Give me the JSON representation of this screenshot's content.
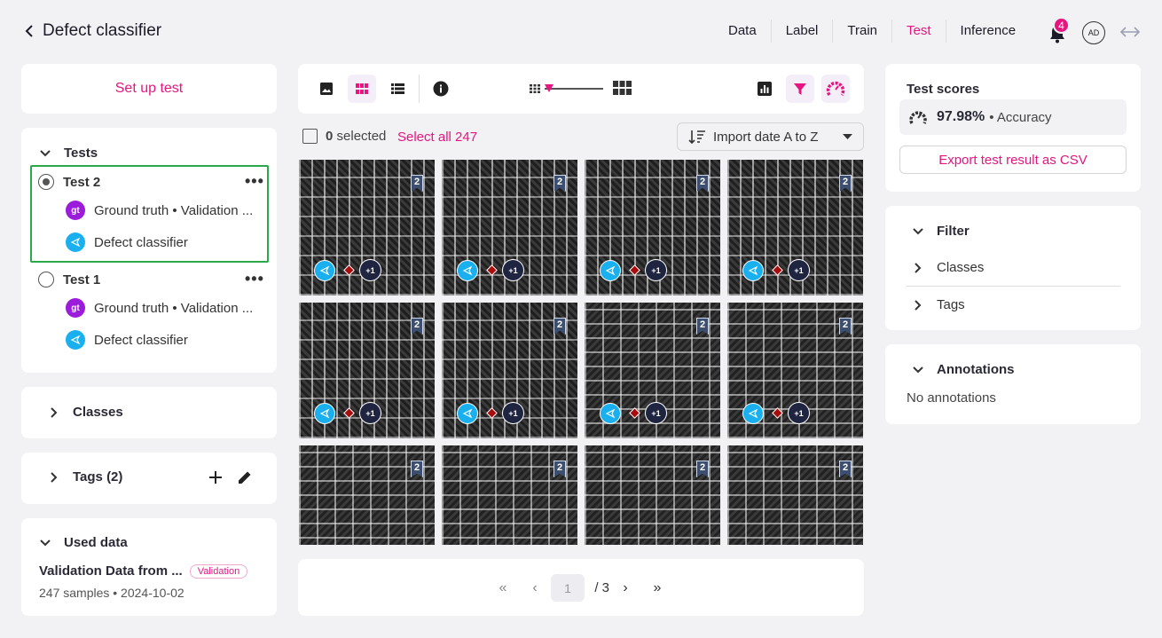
{
  "header": {
    "title": "Defect classifier",
    "nav": [
      "Data",
      "Label",
      "Train",
      "Test",
      "Inference"
    ],
    "active_nav": "Test",
    "notification_count": "4",
    "avatar_initials": "AD"
  },
  "left": {
    "setup_label": "Set up test",
    "tests_heading": "Tests",
    "tests": [
      {
        "name": "Test 2",
        "selected": true,
        "gt_badge": "gt",
        "ground_truth": "Ground truth • Validation ...",
        "model": "Defect classifier"
      },
      {
        "name": "Test 1",
        "selected": false,
        "gt_badge": "gt",
        "ground_truth": "Ground truth • Validation ...",
        "model": "Defect classifier"
      }
    ],
    "more_label": "•••",
    "classes_heading": "Classes",
    "tags_heading": "Tags (2)",
    "used_data_heading": "Used data",
    "dataset_name": "Validation Data from ...",
    "dataset_pill": "Validation",
    "dataset_meta": "247 samples • 2024-10-02"
  },
  "center": {
    "toolbar_icons": [
      "image-view-icon",
      "grid-view-icon",
      "list-view-icon",
      "info-icon",
      "small-grid-icon",
      "large-grid-icon",
      "chart-icon",
      "filter-icon",
      "score-gauge-icon"
    ],
    "thumbnail_size_fraction": 0.2,
    "selected_count": "0",
    "selected_label": "selected",
    "select_all_label": "Select all 247",
    "sort_label": "Import date A to Z",
    "tile_tag": "2",
    "tile_extra": "+1",
    "tile_count": 12,
    "pagination": {
      "first": "«",
      "prev": "‹",
      "current": "1",
      "total": "/ 3",
      "next": "›",
      "last": "»"
    }
  },
  "right": {
    "scores_heading": "Test scores",
    "accuracy_value": "97.98%",
    "accuracy_label": "• Accuracy",
    "export_label": "Export test result as CSV",
    "filter_heading": "Filter",
    "filter_items": [
      "Classes",
      "Tags"
    ],
    "annotations_heading": "Annotations",
    "annotations_empty": "No annotations"
  },
  "colors": {
    "accent": "#e6157f",
    "selection_border": "#2aa84a",
    "model_badge": "#1ab0ef",
    "gt_badge": "#9b1ddb"
  }
}
